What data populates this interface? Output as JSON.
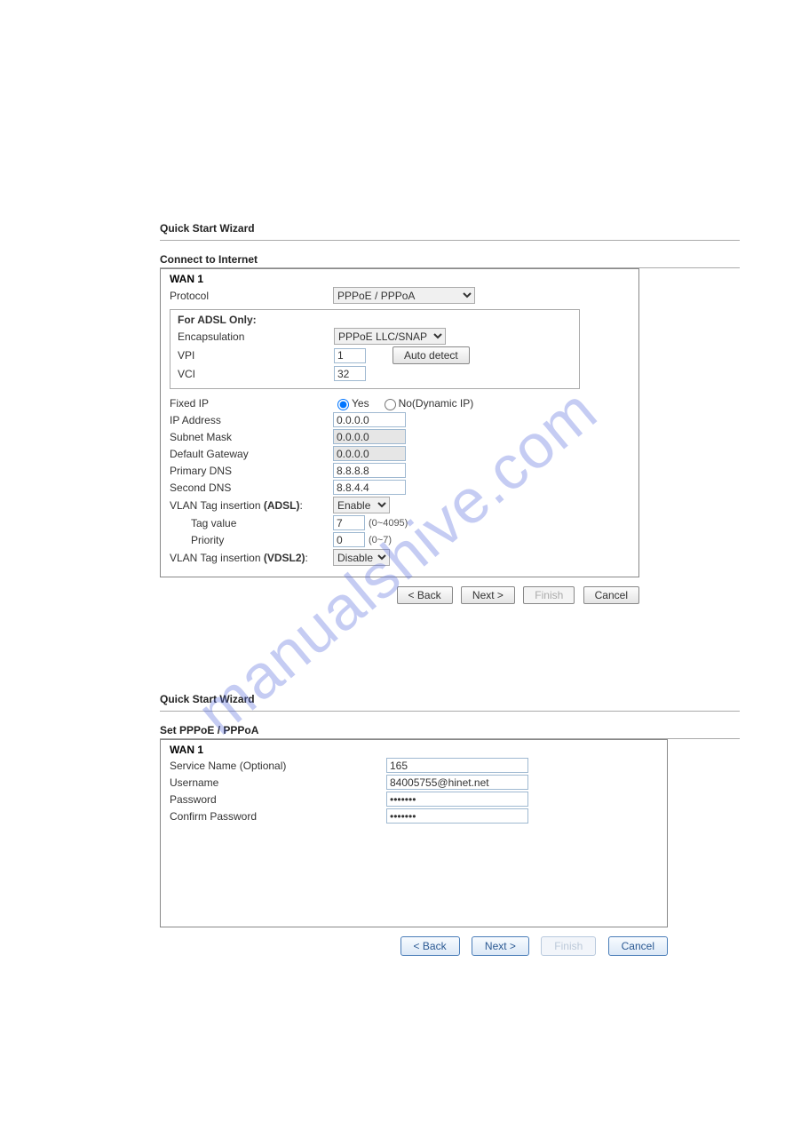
{
  "watermark": "manualshive.com",
  "wizard1": {
    "title": "Quick Start Wizard",
    "section": "Connect to Internet",
    "wan": "WAN 1",
    "protocol_label": "Protocol",
    "protocol_value": "PPPoE / PPPoA",
    "adsl_box": {
      "heading": "For ADSL Only:",
      "encap_label": "Encapsulation",
      "encap_value": "PPPoE LLC/SNAP",
      "vpi_label": "VPI",
      "vpi_value": "1",
      "vci_label": "VCI",
      "vci_value": "32",
      "auto_detect": "Auto detect"
    },
    "fixed_ip_label": "Fixed IP",
    "yes": "Yes",
    "no_label": "No(Dynamic IP)",
    "ip_label": "IP Address",
    "ip_value": "0.0.0.0",
    "subnet_label": "Subnet Mask",
    "subnet_value": "0.0.0.0",
    "gateway_label": "Default Gateway",
    "gateway_value": "0.0.0.0",
    "pdns_label": "Primary DNS",
    "pdns_value": "8.8.8.8",
    "sdns_label": "Second DNS",
    "sdns_value": "8.8.4.4",
    "vlan_adsl_label": "VLAN Tag insertion (ADSL):",
    "vlan_adsl_value": "Enable",
    "tag_label": "Tag value",
    "tag_value": "7",
    "tag_range": "(0~4095)",
    "prio_label": "Priority",
    "prio_value": "0",
    "prio_range": "(0~7)",
    "vlan_vdsl_label": "VLAN Tag insertion (VDSL2):",
    "vlan_vdsl_value": "Disable",
    "buttons": {
      "back": "< Back",
      "next": "Next >",
      "finish": "Finish",
      "cancel": "Cancel"
    }
  },
  "wizard2": {
    "title": "Quick Start Wizard",
    "section": "Set PPPoE / PPPoA",
    "wan": "WAN 1",
    "service_label": "Service Name (Optional)",
    "service_value": "165",
    "user_label": "Username",
    "user_value": "84005755@hinet.net",
    "pass_label": "Password",
    "pass_value": "•••••••",
    "cpass_label": "Confirm Password",
    "cpass_value": "•••••••",
    "buttons": {
      "back": "< Back",
      "next": "Next >",
      "finish": "Finish",
      "cancel": "Cancel"
    }
  }
}
